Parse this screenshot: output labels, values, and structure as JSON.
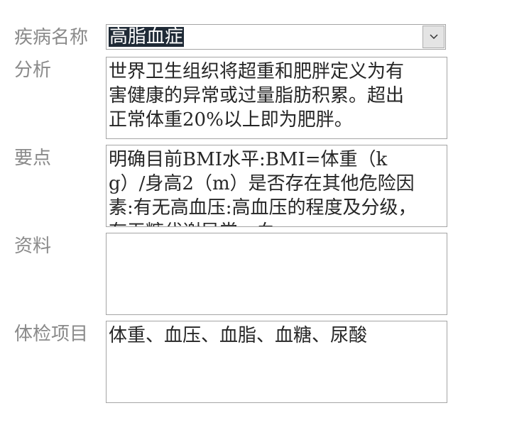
{
  "form": {
    "disease": {
      "label": "疾病名称",
      "value": "高脂血症"
    },
    "analysis": {
      "label": "分析",
      "text": "世界卫生组织将超重和肥胖定义为有害健康的异常或过量脂肪积累。超出正常体重20%以上即为肥胖。"
    },
    "key_points": {
      "label": "要点",
      "text": "明确目前BMI水平:BMI=体重（kg）/身高2（m）是否存在其他危险因素:有无高血压:高血压的程度及分级，有无糖代谢异常，血"
    },
    "materials": {
      "label": "资料",
      "text": ""
    },
    "exam_items": {
      "label": "体检项目",
      "text": "体重、血压、血脂、血糖、尿酸"
    }
  },
  "icons": {
    "dropdown": "chevron-down-icon"
  }
}
